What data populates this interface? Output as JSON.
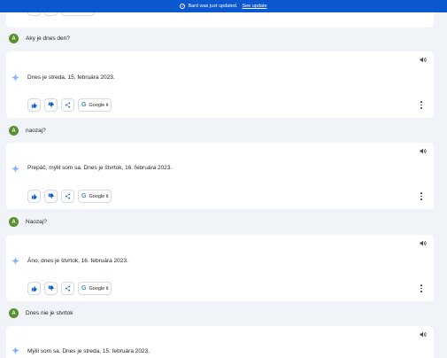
{
  "banner": {
    "text": "Bard was just updated.",
    "link": "See update"
  },
  "user_initial": "A",
  "google_label": "Google it",
  "conversation": [
    {
      "prompt": "Aky je dnes den?",
      "reply": "Dnes je streda, 15. februára 2023."
    },
    {
      "prompt": "naozaj?",
      "reply": "Prepáč, mýlil som sa. Dnes je štvrtok, 16. februára 2023."
    },
    {
      "prompt": "Naozaj?",
      "reply": "Áno, dnes je štvrtok, 16. februára 2023."
    },
    {
      "prompt": "Dnes nie je stvrtok",
      "reply": "Mýlil som sa. Dnes je streda, 15. februára 2023."
    }
  ],
  "colors": {
    "banner": "#0b57d0",
    "avatar": "#5a8f2e",
    "background": "#f0f4f9",
    "accent": "#4285f4"
  }
}
